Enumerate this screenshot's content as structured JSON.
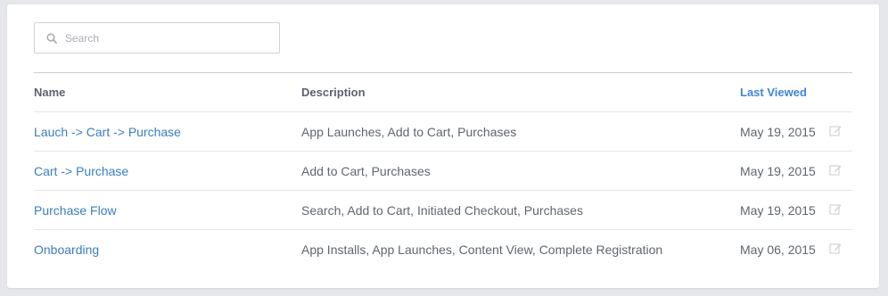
{
  "search": {
    "placeholder": "Search",
    "value": ""
  },
  "table": {
    "columns": {
      "name": "Name",
      "description": "Description",
      "last_viewed": "Last Viewed"
    },
    "sorted_column_color": "#3d86d4",
    "link_color": "#3a7ebf",
    "rows": [
      {
        "name": "Lauch -> Cart -> Purchase",
        "description": "App Launches, Add to Cart, Purchases",
        "last_viewed": "May 19, 2015",
        "action_icon": "edit-icon"
      },
      {
        "name": "Cart -> Purchase",
        "description": "Add to Cart, Purchases",
        "last_viewed": "May 19, 2015",
        "action_icon": "edit-icon"
      },
      {
        "name": "Purchase Flow",
        "description": "Search, Add to Cart, Initiated Checkout, Purchases",
        "last_viewed": "May 19, 2015",
        "action_icon": "edit-icon"
      },
      {
        "name": "Onboarding",
        "description": "App Installs, App Launches, Content View, Complete Registration",
        "last_viewed": "May 06, 2015",
        "action_icon": "edit-icon"
      }
    ]
  }
}
